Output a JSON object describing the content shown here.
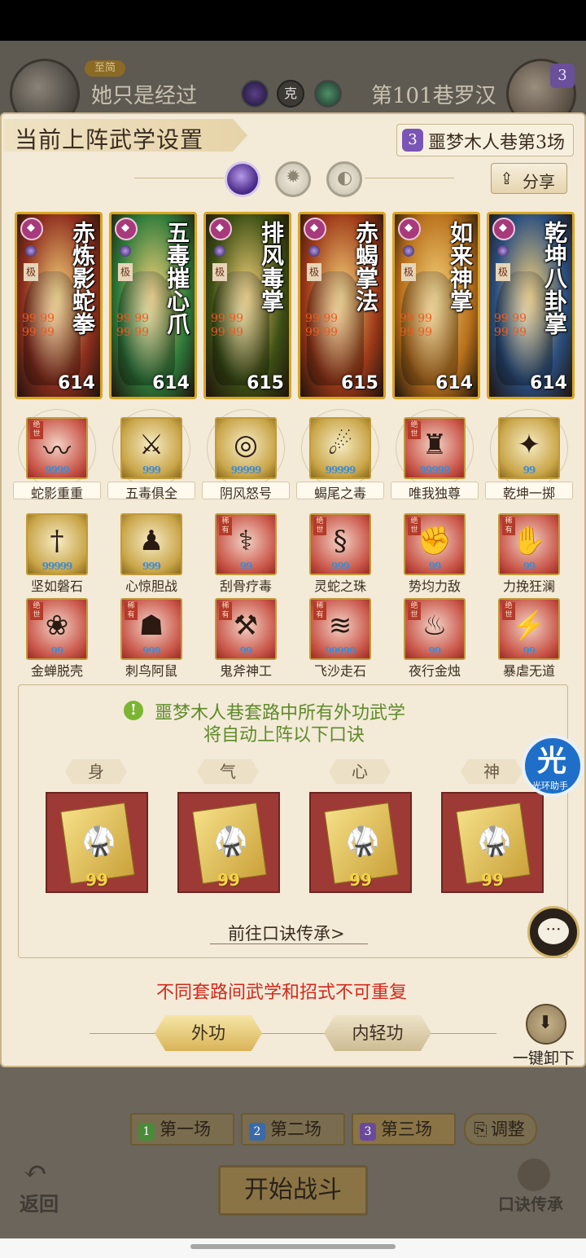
{
  "header": {
    "rank_tag": "至简",
    "player_left": "她只是经过",
    "vs_glyph": "克",
    "player_right": "第101巷罗汉",
    "right_badge": "3"
  },
  "panel": {
    "title": "当前上阵武学设置",
    "stage_num": "3",
    "stage_label": "噩梦木人巷第3场",
    "share_label": "分享"
  },
  "cards": [
    {
      "name": "赤炼影蛇拳",
      "rank": "极",
      "power": "614",
      "drops": "99 99 99 99",
      "tint": "#8e2f1e"
    },
    {
      "name": "五毒摧心爪",
      "rank": "极",
      "power": "614",
      "drops": "99 99 99 99",
      "tint": "#2e7a3a"
    },
    {
      "name": "排风毒掌",
      "rank": "极",
      "power": "615",
      "drops": "99 99 99 99",
      "tint": "#3d4f14"
    },
    {
      "name": "赤蝎掌法",
      "rank": "极",
      "power": "615",
      "drops": "99 99 99 99",
      "tint": "#9e3a18"
    },
    {
      "name": "如来神掌",
      "rank": "极",
      "power": "614",
      "drops": "99 99 99 99",
      "tint": "#b8701c"
    },
    {
      "name": "乾坤八卦掌",
      "rank": "极",
      "power": "614",
      "drops": "99 99 99 99",
      "tint": "#2a4e7e"
    }
  ],
  "moves_row1": [
    {
      "label": "蛇影重重",
      "level": "9999",
      "style": "red",
      "glyph": "〰",
      "tag": "绝世"
    },
    {
      "label": "五毒俱全",
      "level": "999",
      "style": "gold",
      "glyph": "⚔",
      "tag": ""
    },
    {
      "label": "阴风怒号",
      "level": "99999",
      "style": "gold",
      "glyph": "◎",
      "tag": ""
    },
    {
      "label": "蝎尾之毒",
      "level": "99999",
      "style": "gold",
      "glyph": "☄",
      "tag": ""
    },
    {
      "label": "唯我独尊",
      "level": "99999",
      "style": "red",
      "glyph": "♜",
      "tag": "绝世"
    },
    {
      "label": "乾坤一掷",
      "level": "99",
      "style": "gold",
      "glyph": "✦",
      "tag": ""
    }
  ],
  "moves_row2": [
    {
      "label": "坚如磐石",
      "level": "99999",
      "style": "gold",
      "glyph": "†",
      "tag": ""
    },
    {
      "label": "心惊胆战",
      "level": "999",
      "style": "gold",
      "glyph": "♟",
      "tag": ""
    },
    {
      "label": "刮骨疗毒",
      "level": "99",
      "style": "red",
      "glyph": "⚕",
      "tag": "稀有"
    },
    {
      "label": "灵蛇之珠",
      "level": "999",
      "style": "red",
      "glyph": "§",
      "tag": "绝世"
    },
    {
      "label": "势均力敌",
      "level": "99",
      "style": "red",
      "glyph": "✊",
      "tag": "绝世"
    },
    {
      "label": "力挽狂澜",
      "level": "99",
      "style": "red",
      "glyph": "✋",
      "tag": "稀有"
    }
  ],
  "moves_row3": [
    {
      "label": "金蝉脱壳",
      "level": "99",
      "style": "red",
      "glyph": "❀",
      "tag": "绝世"
    },
    {
      "label": "刺鸟阿鼠",
      "level": "999",
      "style": "red",
      "glyph": "☗",
      "tag": "稀有"
    },
    {
      "label": "鬼斧神工",
      "level": "99",
      "style": "red",
      "glyph": "⚒",
      "tag": "稀有"
    },
    {
      "label": "飞沙走石",
      "level": "99999",
      "style": "red",
      "glyph": "≋",
      "tag": "稀有"
    },
    {
      "label": "夜行金烛",
      "level": "99",
      "style": "red",
      "glyph": "♨",
      "tag": "绝世"
    },
    {
      "label": "暴虐无道",
      "level": "99",
      "style": "red",
      "glyph": "⚡",
      "tag": "绝世"
    }
  ],
  "info": {
    "icon": "!",
    "line1": "噩梦木人巷套路中所有外功武学",
    "line2": "将自动上阵以下口诀",
    "categories": [
      "身",
      "气",
      "心",
      "神"
    ],
    "secret_levels": [
      "99",
      "99",
      "99",
      "99"
    ],
    "goto_link": "前往口诀传承>"
  },
  "helper": {
    "glyph": "光",
    "text": "光环助手"
  },
  "warning": "不同套路间武学和招式不可重复",
  "tabs": {
    "active": "外功",
    "idle": "内轻功"
  },
  "unload_label": "一键卸下",
  "rounds": [
    {
      "n": "1",
      "label": "第一场",
      "color": "#4a8a3a"
    },
    {
      "n": "2",
      "label": "第二场",
      "color": "#3a6aa8"
    },
    {
      "n": "3",
      "label": "第三场",
      "color": "#6a4a9a"
    }
  ],
  "adjust_label": "调整",
  "start_label": "开始战斗",
  "back_label": "返回",
  "kj_label": "口诀传承"
}
